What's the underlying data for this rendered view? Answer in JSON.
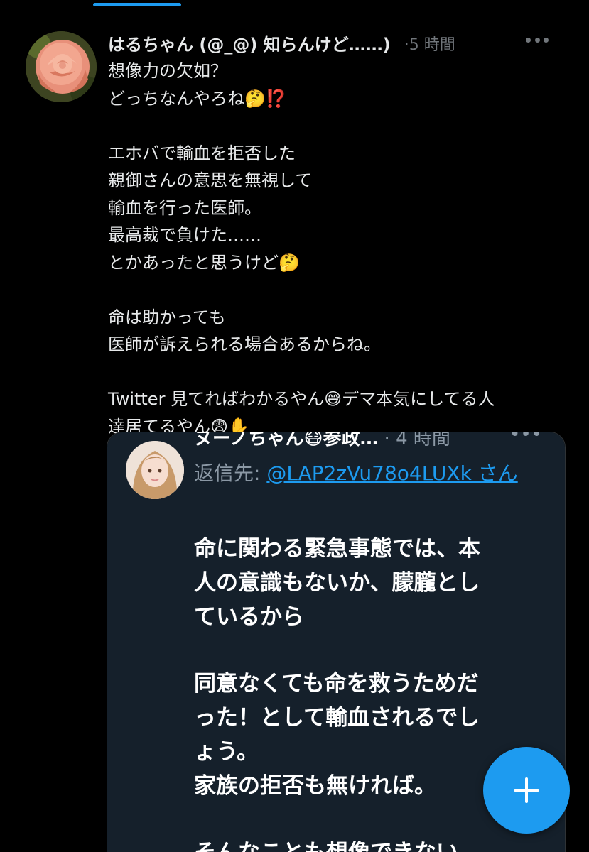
{
  "tweet": {
    "display_name": "はるちゃん (@_@) 知らんけど……)",
    "separator": "·",
    "time": "5 時間",
    "body_lines": [
      "想像力の欠如？",
      "どっちなんやろね🤔⁉️",
      "",
      "エホバで輸血を拒否した",
      "親御さんの意思を無視して",
      "輸血を行った医師。",
      "最高裁で負けた……",
      "とかあったと思うけど🤔",
      "",
      "命は助かっても",
      "医師が訴えられる場合あるからね。",
      "",
      "Twitter 見てればわかるやん😅デマ本気にしてる人",
      "達居てるやん😨✋"
    ]
  },
  "quoted_screenshot": {
    "header_name": "ヌーノちゃん😷参政…",
    "header_time": "· 4 時間",
    "reply_prefix": "返信先: ",
    "reply_handle": "@LAP2zVu78o4LUXk さん",
    "body_lines": [
      "命に関わる緊急事態では、本",
      "人の意識もないか、朦朧とし",
      "ているから",
      "",
      "同意なくても命を救うためだ",
      "った！として輸血されるでし",
      "ょう。",
      "家族の拒否も無ければ。",
      "",
      "そんなことも想像できない"
    ]
  },
  "icons": {
    "more": "more-horizontal-icon",
    "compose": "plus-icon",
    "avatar": "rose-avatar"
  },
  "colors": {
    "background": "#000000",
    "accent": "#1d9bf0",
    "text": "#e7e9ea",
    "muted": "#71767b",
    "screenshot_bg": "#15202b"
  }
}
